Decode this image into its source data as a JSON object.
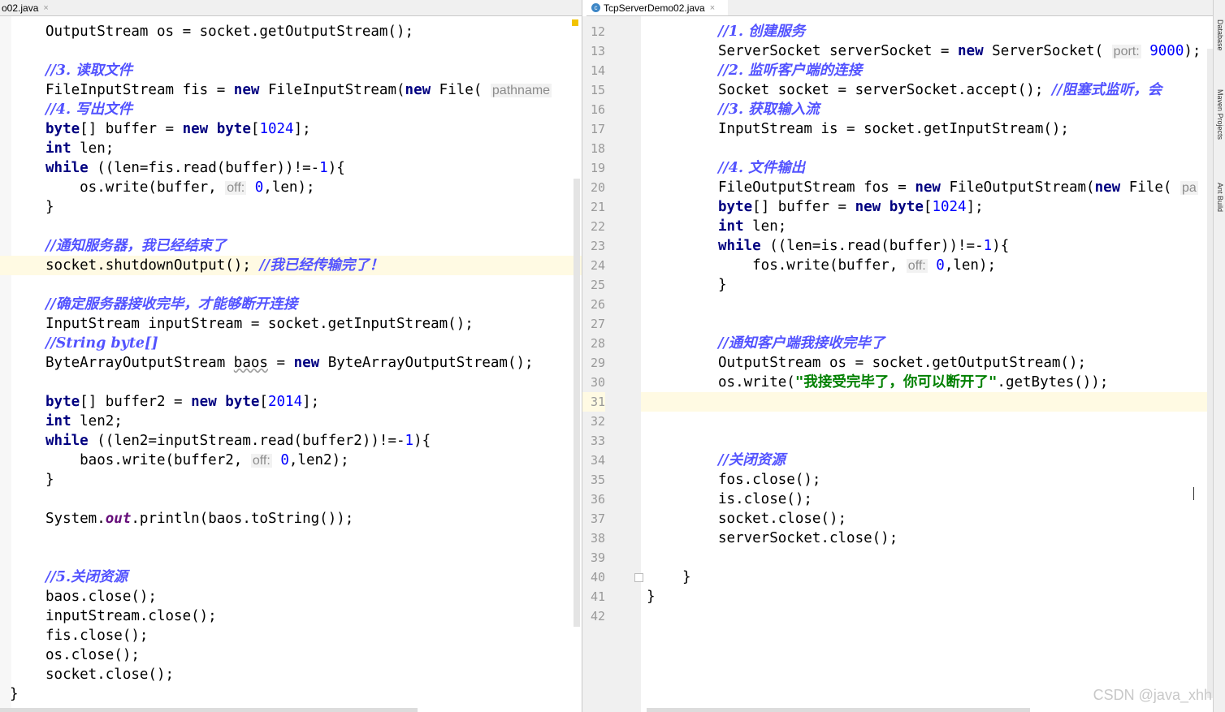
{
  "tabs": {
    "left": "o02.java",
    "right": "TcpServerDemo02.java",
    "close_glyph": "×",
    "java_icon_glyph": "c"
  },
  "side_tools": [
    "Database",
    "Maven Projects",
    "Ant Build"
  ],
  "left_code": {
    "l0": "OutputStream os = socket.getOutputStream();",
    "l2": "//3. 读取文件",
    "l3a": "FileInputStream fis = ",
    "l3kw": "new",
    "l3b": " FileInputStream(",
    "l3kw2": "new",
    "l3c": " File( ",
    "l3hint": "pathname",
    "l4": "//4. 写出文件",
    "l5kw": "byte",
    "l5a": "[] buffer = ",
    "l5kw2": "new",
    "l5kw3": " byte",
    "l5b": "[",
    "l5num": "1024",
    "l5c": "];",
    "l6kw": "int",
    "l6a": " len;",
    "l7kw": "while",
    "l7a": " ((len=fis.read(buffer))!=-",
    "l7num": "1",
    "l7b": "){",
    "l8a": "    os.write(buffer, ",
    "l8hint": "off:",
    "l8num": " 0",
    "l8b": ",len);",
    "l9": "}",
    "l11": "//通知服务器，我已经结束了",
    "l12a": "socket.shutdownOutput(); ",
    "l12cm": "//我已经传输完了！",
    "l14": "//确定服务器接收完毕，才能够断开连接",
    "l15": "InputStream inputStream = socket.getInputStream();",
    "l16": "//String byte[]",
    "l17a": "ByteArrayOutputStream ",
    "l17sq": "baos",
    "l17b": " = ",
    "l17kw": "new",
    "l17c": " ByteArrayOutputStream();",
    "l19kw": "byte",
    "l19a": "[] buffer2 = ",
    "l19kw2": "new",
    "l19kw3": " byte",
    "l19b": "[",
    "l19num": "2014",
    "l19c": "];",
    "l20kw": "int",
    "l20a": " len2;",
    "l21kw": "while",
    "l21a": " ((len2=inputStream.read(buffer2))!=-",
    "l21num": "1",
    "l21b": "){",
    "l22a": "    baos.write(buffer2, ",
    "l22hint": "off:",
    "l22num": " 0",
    "l22b": ",len2);",
    "l23": "}",
    "l25a": "System.",
    "l25fld": "out",
    "l25b": ".println(baos.toString());",
    "l28": "//5.关闭资源",
    "l29": "baos.close();",
    "l30": "inputStream.close();",
    "l31": "fis.close();",
    "l32": "os.close();",
    "l33": "socket.close();",
    "l34": "}"
  },
  "right_line_numbers": [
    "12",
    "13",
    "14",
    "15",
    "16",
    "17",
    "18",
    "19",
    "20",
    "21",
    "22",
    "23",
    "24",
    "25",
    "26",
    "27",
    "28",
    "29",
    "30",
    "31",
    "32",
    "33",
    "34",
    "35",
    "36",
    "37",
    "38",
    "39",
    "40",
    "41",
    "42"
  ],
  "right_code": {
    "r12": "//1. 创建服务",
    "r13a": "ServerSocket serverSocket = ",
    "r13kw": "new",
    "r13b": " ServerSocket( ",
    "r13hint": "port:",
    "r13num": " 9000",
    "r13c": ");",
    "r14": "//2. 监听客户端的连接",
    "r15a": "Socket socket = serverSocket.accept(); ",
    "r15cm": "//阻塞式监听，会",
    "r16": "//3. 获取输入流",
    "r17": "InputStream is = socket.getInputStream();",
    "r19": "//4. 文件输出",
    "r20a": "FileOutputStream fos = ",
    "r20kw": "new",
    "r20b": " FileOutputStream(",
    "r20kw2": "new",
    "r20c": " File( ",
    "r20hint": "pa",
    "r21kw": "byte",
    "r21a": "[] buffer = ",
    "r21kw2": "new",
    "r21kw3": " byte",
    "r21b": "[",
    "r21num": "1024",
    "r21c": "];",
    "r22kw": "int",
    "r22a": " len;",
    "r23kw": "while",
    "r23a": " ((len=is.read(buffer))!=-",
    "r23num": "1",
    "r23b": "){",
    "r24a": "    fos.write(buffer, ",
    "r24hint": "off:",
    "r24num": " 0",
    "r24b": ",len);",
    "r25": "}",
    "r28": "//通知客户端我接收完毕了",
    "r29": "OutputStream os = socket.getOutputStream();",
    "r30a": "os.write(",
    "r30str": "\"我接受完毕了，你可以断开了\"",
    "r30b": ".getBytes());",
    "r34": "//关闭资源",
    "r35": "fos.close();",
    "r36": "is.close();",
    "r37": "socket.close();",
    "r38": "serverSocket.close();",
    "r40": "}",
    "r41": "}"
  },
  "watermark": "CSDN @java_xhh",
  "colors": {
    "keyword": "#000080",
    "number": "#0000ff",
    "comment": "#5353ff",
    "string": "#008000",
    "field": "#660e7a",
    "caret_line": "#fffae3"
  }
}
